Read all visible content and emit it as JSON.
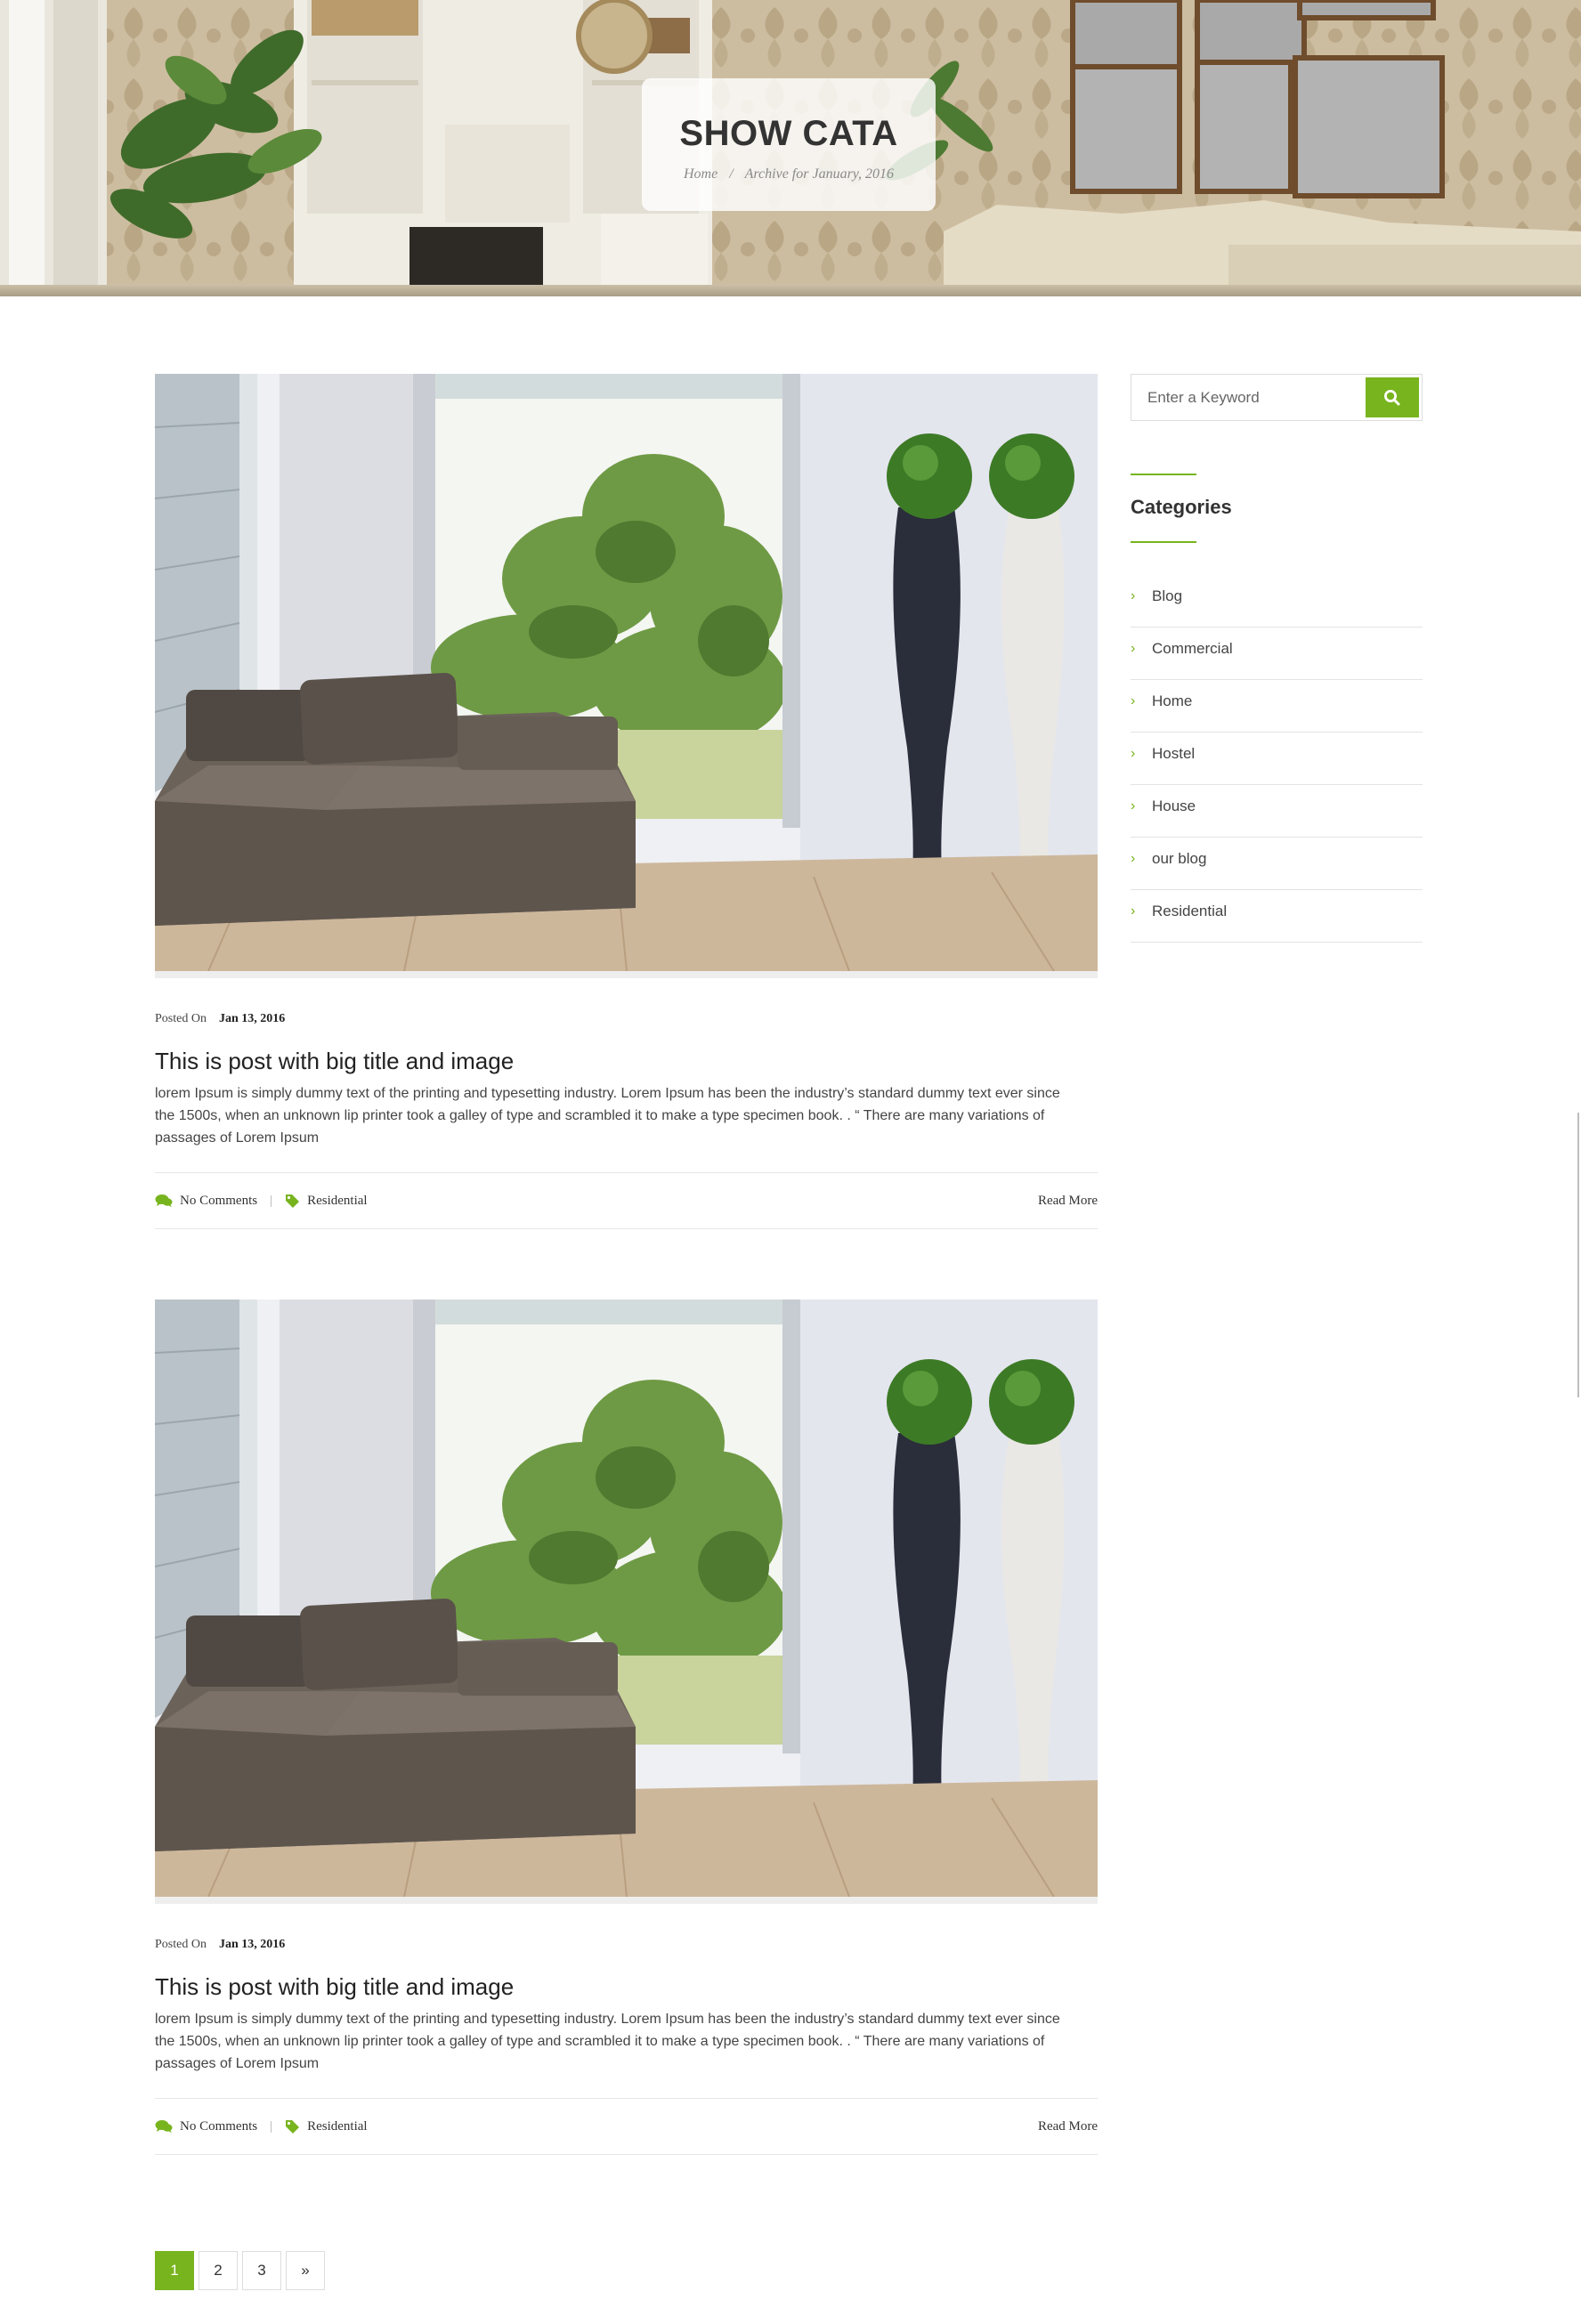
{
  "hero": {
    "title": "SHOW CATA",
    "breadcrumb": {
      "home": "Home",
      "separator": "/",
      "current": "Archive for January, 2016"
    }
  },
  "posts": [
    {
      "posted_label": "Posted On",
      "date": "Jan 13, 2016",
      "title": "This is post with big title and image",
      "excerpt": "lorem Ipsum is simply dummy text of the printing and typesetting industry. Lorem Ipsum has been the industry’s standard dummy text ever since the 1500s, when an unknown lip printer took a galley of type and scrambled it to make a type specimen book. . “ There are many variations of passages of Lorem Ipsum",
      "comments": "No Comments",
      "divider": "|",
      "category": "Residential",
      "read_more": "Read More"
    },
    {
      "posted_label": "Posted On",
      "date": "Jan 13, 2016",
      "title": "This is post with big title and image",
      "excerpt": "lorem Ipsum is simply dummy text of the printing and typesetting industry. Lorem Ipsum has been the industry’s standard dummy text ever since the 1500s, when an unknown lip printer took a galley of type and scrambled it to make a type specimen book. . “ There are many variations of passages of Lorem Ipsum",
      "comments": "No Comments",
      "divider": "|",
      "category": "Residential",
      "read_more": "Read More"
    }
  ],
  "pagination": {
    "pages": [
      "1",
      "2",
      "3"
    ],
    "next": "»",
    "current": "1"
  },
  "sidebar": {
    "search": {
      "placeholder": "Enter a Keyword",
      "icon": "search-icon"
    },
    "categories_title": "Categories",
    "categories": [
      "Blog",
      "Commercial",
      "Home",
      "Hostel",
      "House",
      "our blog",
      "Residential"
    ]
  },
  "colors": {
    "accent": "#78b41e",
    "text": "#333333",
    "border": "#e3e3e3"
  }
}
